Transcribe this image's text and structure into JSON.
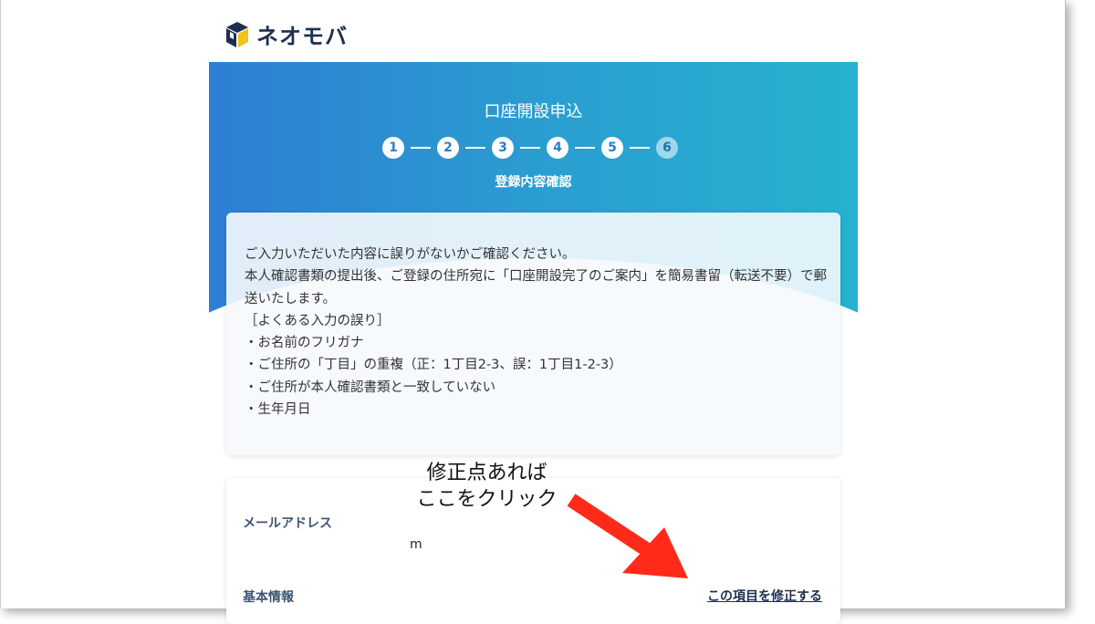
{
  "brand": {
    "name": "ネオモバ",
    "logo_icon": "neomoba-box-logo-icon"
  },
  "hero": {
    "title": "口座開設申込",
    "steps": [
      "1",
      "2",
      "3",
      "4",
      "5",
      "6"
    ],
    "current_step": "6",
    "subtitle": "登録内容確認"
  },
  "notice": {
    "lines": [
      "ご入力いただいた内容に誤りがないかご確認ください。",
      "本人確認書類の提出後、ご登録の住所宛に「口座開設完了のご案内」を簡易書留（転送不要）で郵送いたします。",
      "［よくある入力の誤り］",
      "・お名前のフリガナ",
      "・ご住所の「丁目」の重複（正：1丁目2-3、誤：1丁目1-2-3）",
      "・ご住所が本人確認書類と一致していない",
      "・生年月日"
    ]
  },
  "details": {
    "email_label": "メールアドレス",
    "email_value": "m",
    "basic_info_label": "基本情報",
    "edit_link": "この項目を修正する"
  },
  "annotation": {
    "line1": "修正点あれば",
    "line2": "ここをクリック",
    "arrow_color": "#ff2a1a"
  },
  "colors": {
    "gradient_start": "#2e7ed4",
    "gradient_end": "#26b2cf",
    "label": "#3d5371",
    "brand_text": "#1e2f4f"
  }
}
